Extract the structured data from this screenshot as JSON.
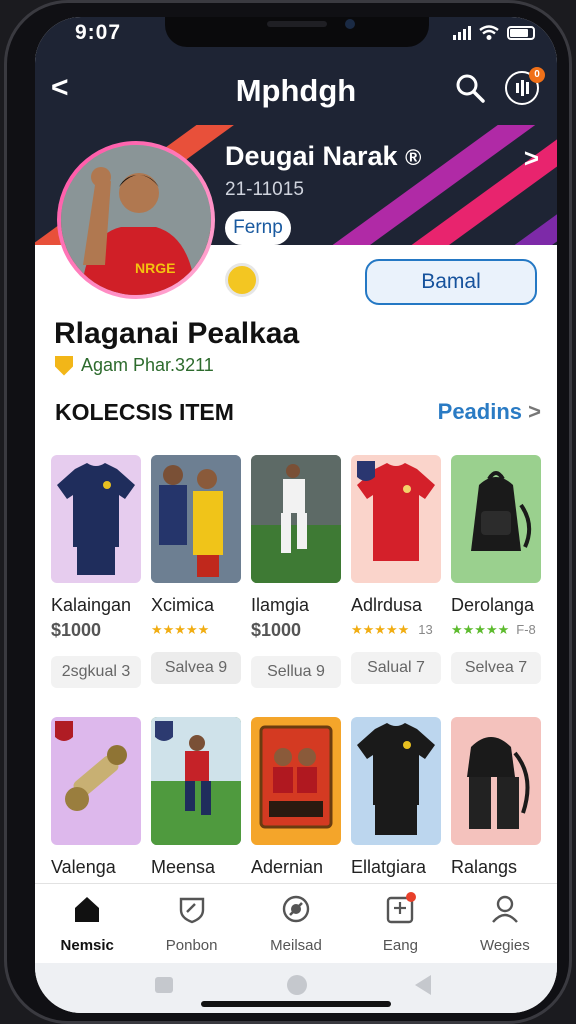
{
  "status": {
    "time": "9:07"
  },
  "header": {
    "title": "Mphdgh",
    "notif_count": "0"
  },
  "profile": {
    "name": "Deugai Narak",
    "name_mark": "®",
    "sub": "21-11015",
    "pill": "Fernp",
    "action_button": "Bamal",
    "person_name": "Rlaganai Pealkaa",
    "person_sub": "Agam Phar.3211"
  },
  "section": {
    "title": "KOLECSIS ITEM",
    "link": "Peadins"
  },
  "row1": [
    {
      "label": "Kalaingan",
      "price": "$1000",
      "count": "2sgkual 3"
    },
    {
      "label": "Xcimica",
      "stars": "★★★★★",
      "count": "Salvea 9"
    },
    {
      "label": "Ilamgia",
      "price": "$1000",
      "count": "Sellua 9"
    },
    {
      "label": "Adlrdusa",
      "stars": "★★★★★",
      "note": "13",
      "count": "Salual 7"
    },
    {
      "label": "Derolanga",
      "stars": "★★★★★",
      "note": "F-8",
      "count": "Selvea 7"
    }
  ],
  "row2": [
    {
      "label": "Valenga"
    },
    {
      "label": "Meensa"
    },
    {
      "label": "Adernian"
    },
    {
      "label": "Ellatgiara"
    },
    {
      "label": "Ralangs"
    }
  ],
  "tabs": [
    {
      "label": "Nemsic",
      "icon": "home-icon"
    },
    {
      "label": "Ponbon",
      "icon": "shield-icon"
    },
    {
      "label": "Meilsad",
      "icon": "ball-icon"
    },
    {
      "label": "Eang",
      "icon": "board-icon"
    },
    {
      "label": "Wegies",
      "icon": "user-icon"
    }
  ],
  "colors": {
    "accent": "#2a7bc4",
    "header": "#1e2434",
    "ring": "#ff4fa3"
  }
}
